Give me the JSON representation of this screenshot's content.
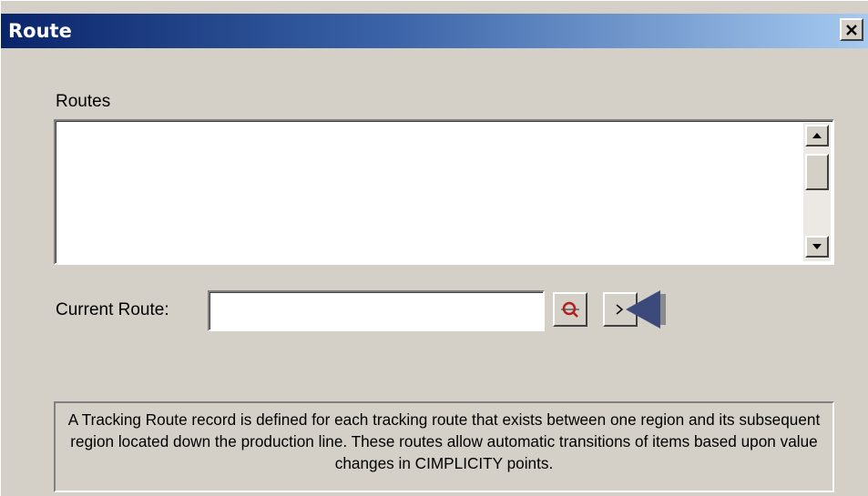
{
  "window": {
    "title": "Route",
    "close_glyph": "✕"
  },
  "routes": {
    "label": "Routes",
    "items": []
  },
  "current_route": {
    "label": "Current Route:",
    "value": "",
    "browse_icon": "browse-search-icon",
    "next_icon": "expand-arrow-icon"
  },
  "info": {
    "text": "A Tracking Route record is defined for each tracking route that exists between one region and its subsequent region located down the production line.  These routes allow automatic transitions of items based upon value changes in CIMPLICITY points."
  },
  "colors": {
    "title_gradient_start": "#0a246a",
    "title_gradient_end": "#a6caf0",
    "dialog_face": "#d4d0c8",
    "arrow_marker": "#3b4a7a",
    "browse_icon_red": "#b02020"
  }
}
